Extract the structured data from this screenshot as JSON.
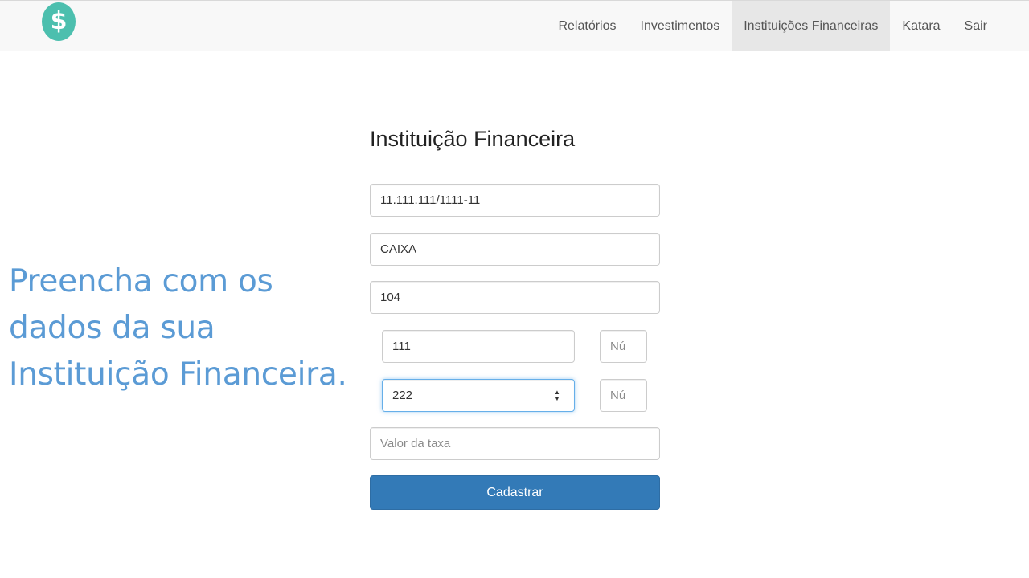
{
  "navbar": {
    "logo_symbol": "$",
    "logo_color": "#4cbfae",
    "items": [
      {
        "label": "Relatórios",
        "active": false
      },
      {
        "label": "Investimentos",
        "active": false
      },
      {
        "label": "Instituições Financeiras",
        "active": true
      },
      {
        "label": "Katara",
        "active": false
      },
      {
        "label": "Sair",
        "active": false
      }
    ]
  },
  "instruction": {
    "line1": "Preencha com os",
    "line2": "dados da sua",
    "line3": "Instituição Financeira.",
    "color": "#5b9bd5"
  },
  "form": {
    "title": "Instituição Financeira",
    "cnpj_value": "11.111.111/1111-11",
    "name_value": "CAIXA",
    "code_value": "104",
    "agencia_value": "111",
    "agencia_digit_placeholder": "Nú",
    "conta_value": "222",
    "conta_digit_placeholder": "Nú",
    "taxa_placeholder": "Valor da taxa",
    "submit_label": "Cadastrar",
    "submit_color": "#337ab7"
  }
}
